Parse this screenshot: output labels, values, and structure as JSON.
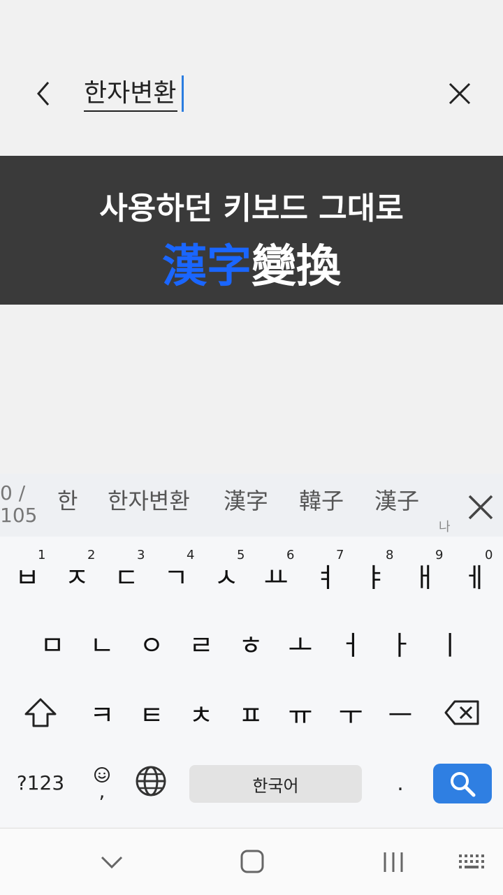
{
  "search": {
    "query": "한자변환"
  },
  "banner": {
    "line1": "사용하던 키보드 그대로",
    "title_blue": "漢字",
    "title_white": "變換"
  },
  "suggestions": {
    "counter": "0 / 105",
    "items": [
      "한",
      "한자변환",
      "漢字",
      "韓子",
      "漢子"
    ],
    "hint": "나"
  },
  "keyboard": {
    "row1": [
      {
        "key": "ㅂ",
        "num": "1"
      },
      {
        "key": "ㅈ",
        "num": "2"
      },
      {
        "key": "ㄷ",
        "num": "3"
      },
      {
        "key": "ㄱ",
        "num": "4"
      },
      {
        "key": "ㅅ",
        "num": "5"
      },
      {
        "key": "ㅛ",
        "num": "6"
      },
      {
        "key": "ㅕ",
        "num": "7"
      },
      {
        "key": "ㅑ",
        "num": "8"
      },
      {
        "key": "ㅐ",
        "num": "9"
      },
      {
        "key": "ㅔ",
        "num": "0"
      }
    ],
    "row2": [
      "ㅁ",
      "ㄴ",
      "ㅇ",
      "ㄹ",
      "ㅎ",
      "ㅗ",
      "ㅓ",
      "ㅏ",
      "ㅣ"
    ],
    "row3": [
      "ㅋ",
      "ㅌ",
      "ㅊ",
      "ㅍ",
      "ㅠ",
      "ㅜ",
      "ㅡ"
    ],
    "symbols_label": "?123",
    "comma_label": ",",
    "space_label": "한국어",
    "period_label": "."
  }
}
